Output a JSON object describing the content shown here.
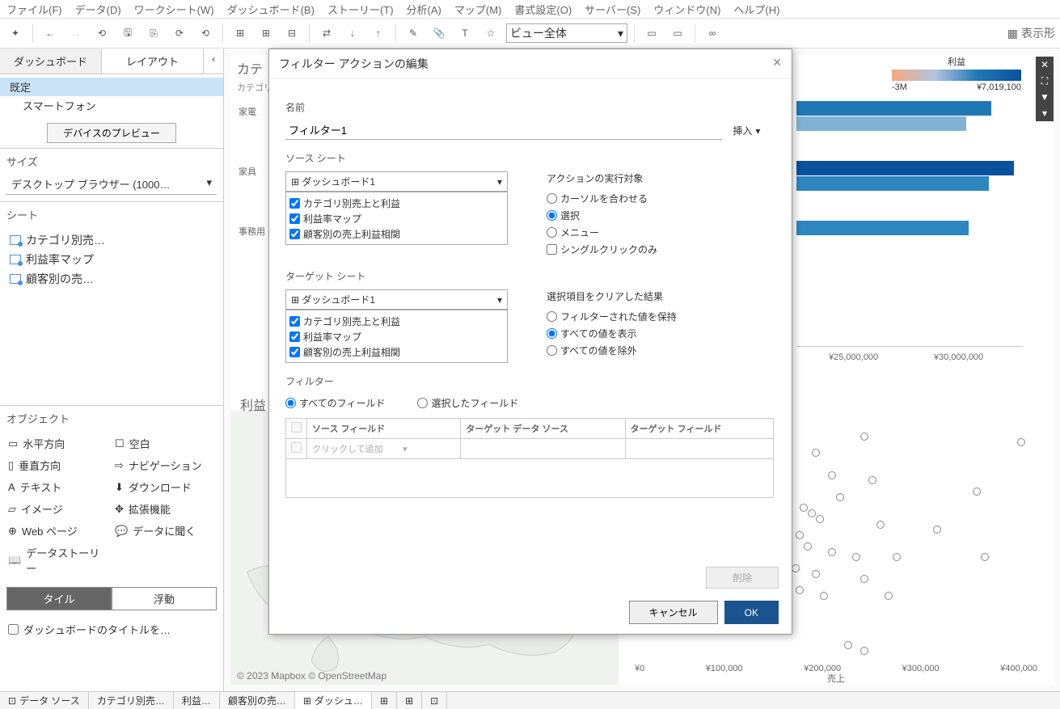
{
  "menubar": [
    "ファイル(F)",
    "データ(D)",
    "ワークシート(W)",
    "ダッシュボード(B)",
    "ストーリー(T)",
    "分析(A)",
    "マップ(M)",
    "書式設定(O)",
    "サーバー(S)",
    "ウィンドウ(N)",
    "ヘルプ(H)"
  ],
  "toolbar": {
    "view_select": "ビュー全体",
    "show_me": "表示形"
  },
  "left": {
    "tabs": {
      "dashboard": "ダッシュボード",
      "layout": "レイアウト"
    },
    "devices": {
      "default": "既定",
      "smartphone": "スマートフォン",
      "preview_btn": "デバイスのプレビュー"
    },
    "size": {
      "label": "サイズ",
      "value": "デスクトップ ブラウザー (1000…"
    },
    "sheets": {
      "label": "シート",
      "items": [
        "カテゴリ別売…",
        "利益率マップ",
        "顧客別の売…"
      ]
    },
    "objects": {
      "label": "オブジェクト",
      "col1": [
        "水平方向",
        "垂直方向",
        "テキスト",
        "イメージ",
        "Web ページ",
        "データストーリー"
      ],
      "col2": [
        "空白",
        "ナビゲーション",
        "ダウンロード",
        "拡張機能",
        "データに聞く"
      ]
    },
    "tile": "タイル",
    "float": "浮動",
    "show_title": "ダッシュボードのタイトルを…"
  },
  "dashboard": {
    "chart1_title": "カテ",
    "chart1_sub": "カテゴリ",
    "row_labels": [
      "家電",
      "家具",
      "事務用"
    ],
    "legend_title": "利益",
    "legend_min": "-3M",
    "legend_max": "¥7,019,100",
    "x_ticks": [
      "¥25,000,000",
      "¥30,000,000"
    ],
    "chart2_title": "利益",
    "scatter_xlabel": "売上",
    "scatter_ticks": [
      "¥0",
      "¥100,000",
      "¥200,000",
      "¥300,000",
      "¥400,000"
    ],
    "map_copyright": "© 2023 Mapbox © OpenStreetMap"
  },
  "dialog": {
    "title": "フィルター アクションの編集",
    "name_label": "名前",
    "name_value": "フィルター1",
    "insert": "挿入",
    "source_label": "ソース シート",
    "source_select": "ダッシュボード1",
    "source_items": [
      "カテゴリ別売上と利益",
      "利益率マップ",
      "顧客別の売上利益相関"
    ],
    "run_on_label": "アクションの実行対象",
    "run_options": [
      "カーソルを合わせる",
      "選択",
      "メニュー"
    ],
    "single_click": "シングルクリックのみ",
    "target_label": "ターゲット シート",
    "target_select": "ダッシュボード1",
    "target_items": [
      "カテゴリ別売上と利益",
      "利益率マップ",
      "顧客別の売上利益相関"
    ],
    "clear_label": "選択項目をクリアした結果",
    "clear_options": [
      "フィルターされた値を保持",
      "すべての値を表示",
      "すべての値を除外"
    ],
    "filter_label": "フィルター",
    "filter_radio": [
      "すべてのフィールド",
      "選択したフィールド"
    ],
    "table_headers": [
      "ソース フィールド",
      "ターゲット データ ソース",
      "ターゲット フィールド"
    ],
    "click_to_add": "クリックして追加",
    "delete_btn": "削除",
    "cancel": "キャンセル",
    "ok": "OK"
  },
  "bottom_tabs": [
    "データ ソース",
    "カテゴリ別売…",
    "利益…",
    "顧客別の売…",
    "ダッシュ…"
  ],
  "chart_data": {
    "type": "bar",
    "title": "カテゴリ別売上と利益",
    "categories": [
      "家電",
      "家具",
      "事務用"
    ],
    "series_note": "partially occluded by dialog; values estimated from visible right bar ends",
    "x_visible_max": 33000000,
    "legend": {
      "field": "利益",
      "min": -3000000,
      "max": 7019100
    }
  }
}
